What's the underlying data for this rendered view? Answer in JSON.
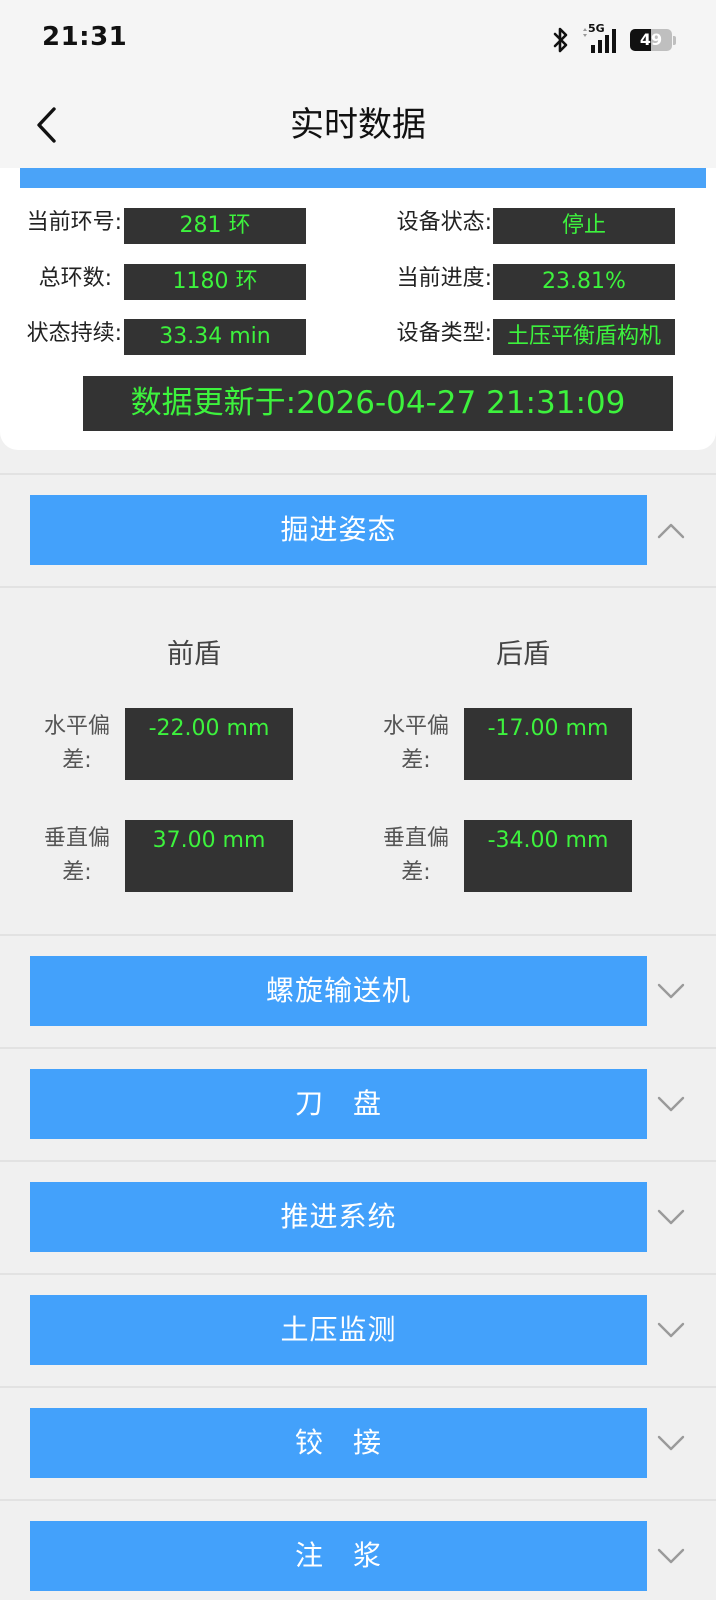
{
  "status_bar": {
    "time": "21:31",
    "network": "5G",
    "battery": "49",
    "battery_fraction": 0.49,
    "icons": [
      "bluetooth-icon",
      "signal-icon",
      "battery-icon"
    ]
  },
  "header": {
    "title": "实时数据",
    "back_icon": "chevron-left-icon"
  },
  "info": {
    "ring_label": "当前环号:",
    "ring_value": "281 环",
    "status_label": "设备状态:",
    "status_value": "停止",
    "total_label": "总环数:",
    "total_value": "1180 环",
    "progress_label": "当前进度:",
    "progress_value": "23.81%",
    "duration_label": "状态持续:",
    "duration_value": "33.34 min",
    "type_label": "设备类型:",
    "type_value": "土压平衡盾构机",
    "update_text": "数据更新于:2026-04-27 21:31:09"
  },
  "attitude": {
    "title": "掘进姿态",
    "expanded": true,
    "front": {
      "title": "前盾",
      "h_label": "水平偏差:",
      "h_value": "-22.00 mm",
      "v_label": "垂直偏差:",
      "v_value": "37.00 mm"
    },
    "rear": {
      "title": "后盾",
      "h_label": "水平偏差:",
      "h_value": "-17.00 mm",
      "v_label": "垂直偏差:",
      "v_value": "-34.00 mm"
    }
  },
  "sections": [
    {
      "label": "螺旋输送机",
      "expanded": false
    },
    {
      "label": "刀　盘",
      "expanded": false
    },
    {
      "label": "推进系统",
      "expanded": false
    },
    {
      "label": "土压监测",
      "expanded": false
    },
    {
      "label": "铰　接",
      "expanded": false
    },
    {
      "label": "注　浆",
      "expanded": false
    }
  ],
  "colors": {
    "accent_blue": "#43a1fb",
    "value_green": "#3df23d",
    "value_bg": "#333333",
    "page_bg": "#f0f0f0"
  }
}
